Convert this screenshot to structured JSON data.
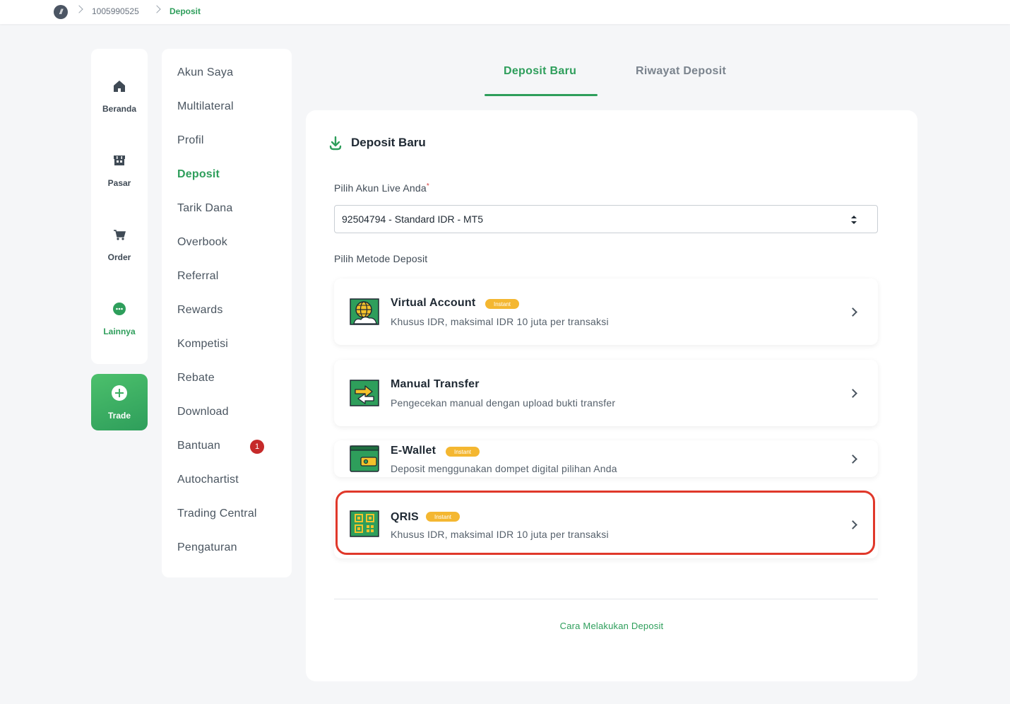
{
  "breadcrumb": {
    "logo_text": "//",
    "account_id": "1005990525",
    "current": "Deposit"
  },
  "rail": {
    "items": [
      {
        "label": "Beranda",
        "icon": "home-icon"
      },
      {
        "label": "Pasar",
        "icon": "store-icon"
      },
      {
        "label": "Order",
        "icon": "cart-icon"
      },
      {
        "label": "Lainnya",
        "icon": "more-dots-icon"
      }
    ],
    "trade_label": "Trade"
  },
  "menu": {
    "items": [
      "Akun Saya",
      "Multilateral",
      "Profil",
      "Deposit",
      "Tarik Dana",
      "Overbook",
      "Referral",
      "Rewards",
      "Kompetisi",
      "Rebate",
      "Download",
      "Bantuan",
      "Autochartist",
      "Trading Central",
      "Pengaturan"
    ],
    "active": "Deposit",
    "bantuan_badge": "1"
  },
  "tabs": {
    "new_deposit": "Deposit Baru",
    "history": "Riwayat Deposit"
  },
  "card": {
    "title": "Deposit Baru",
    "account_label": "Pilih Akun Live Anda",
    "required_mark": "*",
    "account_value": "92504794 - Standard IDR  - MT5",
    "method_label": "Pilih Metode Deposit",
    "instant_label": "Instant",
    "methods": [
      {
        "title": "Virtual Account",
        "desc": "Khusus IDR, maksimal IDR 10 juta per transaksi",
        "instant": true,
        "icon": "globe-icon"
      },
      {
        "title": "Manual Transfer",
        "desc": "Pengecekan manual dengan upload bukti transfer",
        "instant": false,
        "icon": "transfer-arrows-icon"
      },
      {
        "title": "E-Wallet",
        "desc": "Deposit menggunakan dompet digital pilihan Anda",
        "instant": true,
        "icon": "wallet-icon"
      },
      {
        "title": "QRIS",
        "desc": "Khusus IDR, maksimal IDR 10 juta per transaksi",
        "instant": true,
        "icon": "qr-code-icon"
      }
    ],
    "how_to_link": "Cara Melakukan Deposit"
  },
  "colors": {
    "brand_green": "#2e9e5b",
    "instant_badge": "#f4b731",
    "highlight_red": "#e0382a"
  }
}
